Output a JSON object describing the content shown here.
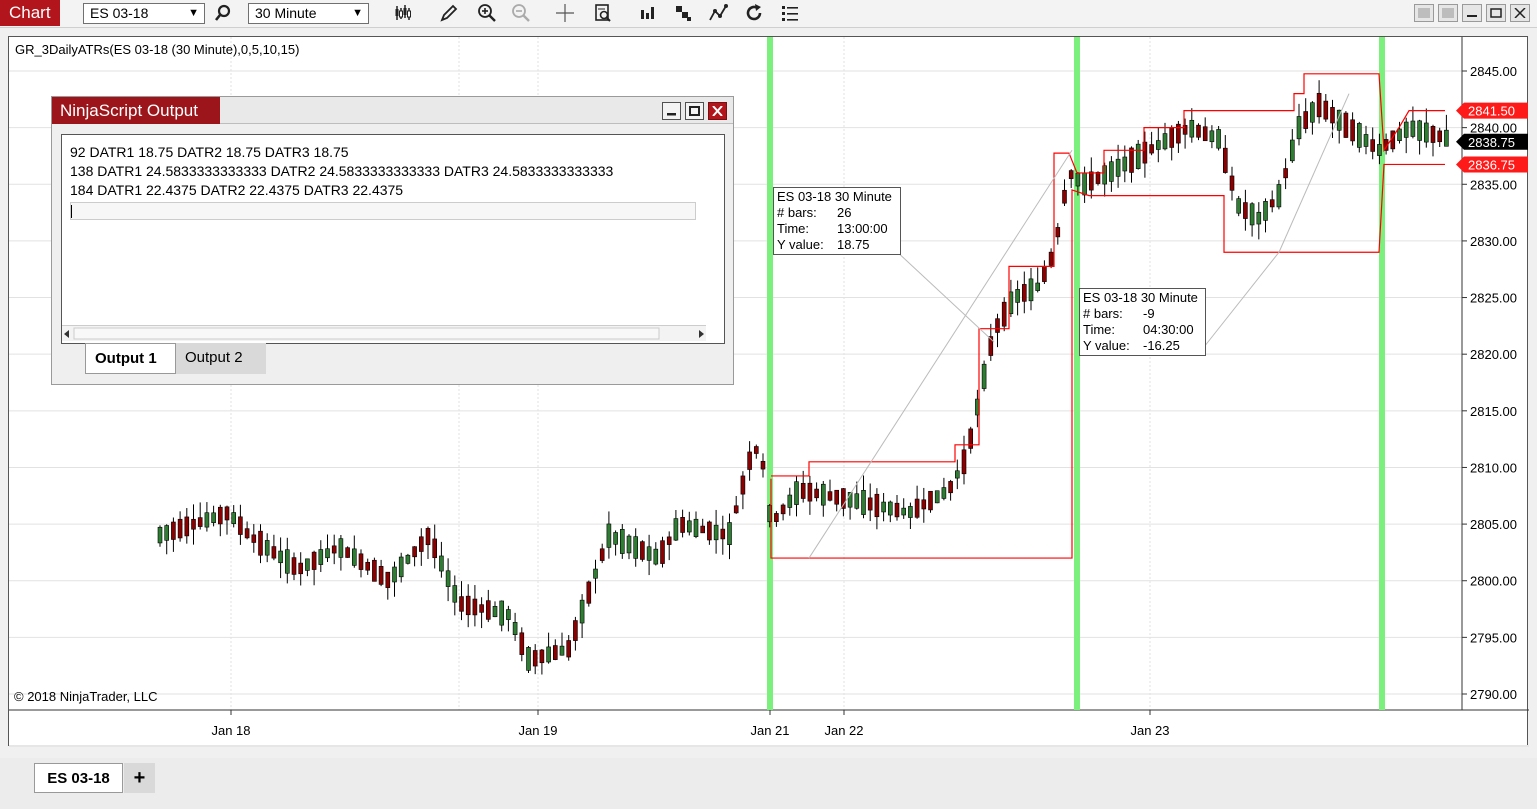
{
  "toolbar": {
    "chart_label": "Chart",
    "instrument": "ES 03-18",
    "interval": "30 Minute",
    "icons": [
      "search-icon",
      "bar-type-icon",
      "draw-icon",
      "zoom-in-icon",
      "zoom-out-icon",
      "crosshair-icon",
      "data-box-icon",
      "strategy-icon",
      "indicator-icon",
      "draw-tools-icon",
      "reload-icon",
      "properties-icon"
    ]
  },
  "chart": {
    "indicator_label": "GR_3DailyATRs(ES 03-18 (30 Minute),0,5,10,15)",
    "copyright": "© 2018 NinjaTrader, LLC",
    "up_color": "#2e7d32",
    "down_color": "#8b0000",
    "atr_color": "#ff0000",
    "session_color": "#7cf07c",
    "price_labels": {
      "upper": "2841.50",
      "last": "2838.75",
      "lower": "2836.75"
    },
    "tooltip1": {
      "title": "ES 03-18 30 Minute",
      "bars_label": "# bars:",
      "bars": "26",
      "time_label": "Time:",
      "time": "13:00:00",
      "y_label": "Y value:",
      "y": "18.75"
    },
    "tooltip2": {
      "title": "ES 03-18 30 Minute",
      "bars_label": "# bars:",
      "bars": "-9",
      "time_label": "Time:",
      "time": "04:30:00",
      "y_label": "Y value:",
      "y": "-16.25"
    }
  },
  "chart_data": {
    "type": "candlestick",
    "ylim": [
      2788.5,
      2849.5
    ],
    "y_ticks": [
      2790,
      2795,
      2800,
      2805,
      2810,
      2815,
      2820,
      2825,
      2830,
      2835,
      2840,
      2845
    ],
    "x_ticks": [
      "Jan 18",
      "Jan 19",
      "Jan 21",
      "Jan 22",
      "Jan 23"
    ],
    "atr_upper": [
      2809.25,
      2810.5,
      2810.5,
      2812,
      2822.25,
      2827.75,
      2837.75,
      2836,
      2838,
      2840,
      2841.5,
      2843,
      2844.75,
      2841.5
    ],
    "atr_lower": [
      2802,
      2802,
      2834,
      2834,
      2829,
      2829,
      2836.75
    ]
  },
  "output_window": {
    "title": "NinjaScript Output",
    "lines": [
      "92 DATR1 18.75 DATR2 18.75 DATR3 18.75",
      "138 DATR1 24.5833333333333 DATR2 24.5833333333333 DATR3 24.5833333333333",
      "184 DATR1 22.4375 DATR2 22.4375 DATR3 22.4375"
    ],
    "tab1": "Output 1",
    "tab2": "Output 2"
  },
  "bottom_tabs": {
    "active": "ES 03-18",
    "add": "+"
  }
}
